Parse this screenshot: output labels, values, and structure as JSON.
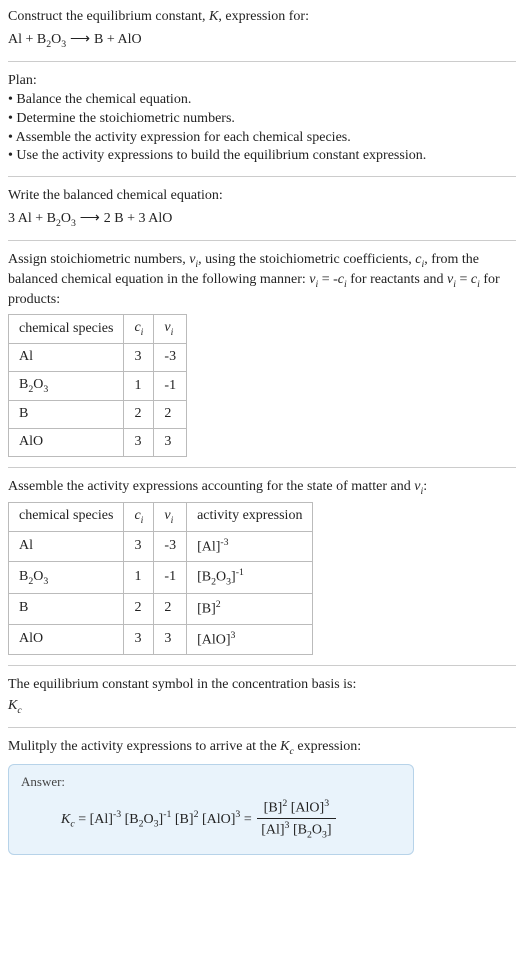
{
  "intro": {
    "line1a": "Construct the equilibrium constant, ",
    "K": "K",
    "line1b": ", expression for:",
    "eq_lhs": "Al + B",
    "eq_sub1": "2",
    "eq_mid1": "O",
    "eq_sub2": "3",
    "arrow": " ⟶ ",
    "eq_rhs": "B + AlO"
  },
  "plan": {
    "title": "Plan:",
    "b1": "• Balance the chemical equation.",
    "b2": "• Determine the stoichiometric numbers.",
    "b3": "• Assemble the activity expression for each chemical species.",
    "b4": "• Use the activity expressions to build the equilibrium constant expression."
  },
  "balanced": {
    "label": "Write the balanced chemical equation:",
    "lhs1": "3 Al + B",
    "sub1": "2",
    "mid1": "O",
    "sub2": "3",
    "arrow": " ⟶ ",
    "rhs": "2 B + 3 AlO"
  },
  "assign": {
    "p1a": "Assign stoichiometric numbers, ",
    "nu": "ν",
    "isub": "i",
    "p1b": ", using the stoichiometric coefficients, ",
    "c": "c",
    "p1c": ", from the balanced chemical equation in the following manner: ",
    "rel1a": "ν",
    "rel1b": " = -",
    "rel1c": "c",
    "p1d": " for reactants and ",
    "rel2a": "ν",
    "rel2b": " = ",
    "rel2c": "c",
    "p1e": " for products:"
  },
  "table1": {
    "h1": "chemical species",
    "h2": "c",
    "h3": "ν",
    "rows": [
      {
        "sp_a": "Al",
        "sp_b": "",
        "sp_c": "",
        "sp_d": "",
        "c": "3",
        "nu": "-3"
      },
      {
        "sp_a": "B",
        "sp_b": "2",
        "sp_c": "O",
        "sp_d": "3",
        "c": "1",
        "nu": "-1"
      },
      {
        "sp_a": "B",
        "sp_b": "",
        "sp_c": "",
        "sp_d": "",
        "c": "2",
        "nu": "2"
      },
      {
        "sp_a": "AlO",
        "sp_b": "",
        "sp_c": "",
        "sp_d": "",
        "c": "3",
        "nu": "3"
      }
    ]
  },
  "assemble": {
    "text_a": "Assemble the activity expressions accounting for the state of matter and ",
    "nu": "ν",
    "isub": "i",
    "text_b": ":"
  },
  "table2": {
    "h1": "chemical species",
    "h2": "c",
    "h3": "ν",
    "h4": "activity expression",
    "rows": [
      {
        "sp_a": "Al",
        "sp_b": "",
        "sp_c": "",
        "sp_d": "",
        "c": "3",
        "nu": "-3",
        "ae_a": "[Al]",
        "ae_sup": "-3"
      },
      {
        "sp_a": "B",
        "sp_b": "2",
        "sp_c": "O",
        "sp_d": "3",
        "c": "1",
        "nu": "-1",
        "ae_a": "[B",
        "ae_sub1": "2",
        "ae_b": "O",
        "ae_sub2": "3",
        "ae_c": "]",
        "ae_sup": "-1"
      },
      {
        "sp_a": "B",
        "sp_b": "",
        "sp_c": "",
        "sp_d": "",
        "c": "2",
        "nu": "2",
        "ae_a": "[B]",
        "ae_sup": "2"
      },
      {
        "sp_a": "AlO",
        "sp_b": "",
        "sp_c": "",
        "sp_d": "",
        "c": "3",
        "nu": "3",
        "ae_a": "[AlO]",
        "ae_sup": "3"
      }
    ]
  },
  "symboltext": {
    "line1": "The equilibrium constant symbol in the concentration basis is:",
    "K": "K",
    "csub": "c"
  },
  "multiply": {
    "text_a": "Mulitply the activity expressions to arrive at the ",
    "K": "K",
    "csub": "c",
    "text_b": " expression:"
  },
  "answer": {
    "label": "Answer:",
    "K": "K",
    "csub": "c",
    "eq": " = ",
    "t1": "[Al]",
    "e1": "-3",
    "t2": " [B",
    "s2a": "2",
    "t2b": "O",
    "s2b": "3",
    "t2c": "]",
    "e2": "-1",
    "t3": " [B]",
    "e3": "2",
    "t4": " [AlO]",
    "e4": "3",
    "eq2": " = ",
    "num_a": "[B]",
    "num_e1": "2",
    "num_b": " [AlO]",
    "num_e2": "3",
    "den_a": "[Al]",
    "den_e1": "3",
    "den_b": " [B",
    "den_s1": "2",
    "den_c": "O",
    "den_s2": "3",
    "den_d": "]"
  }
}
